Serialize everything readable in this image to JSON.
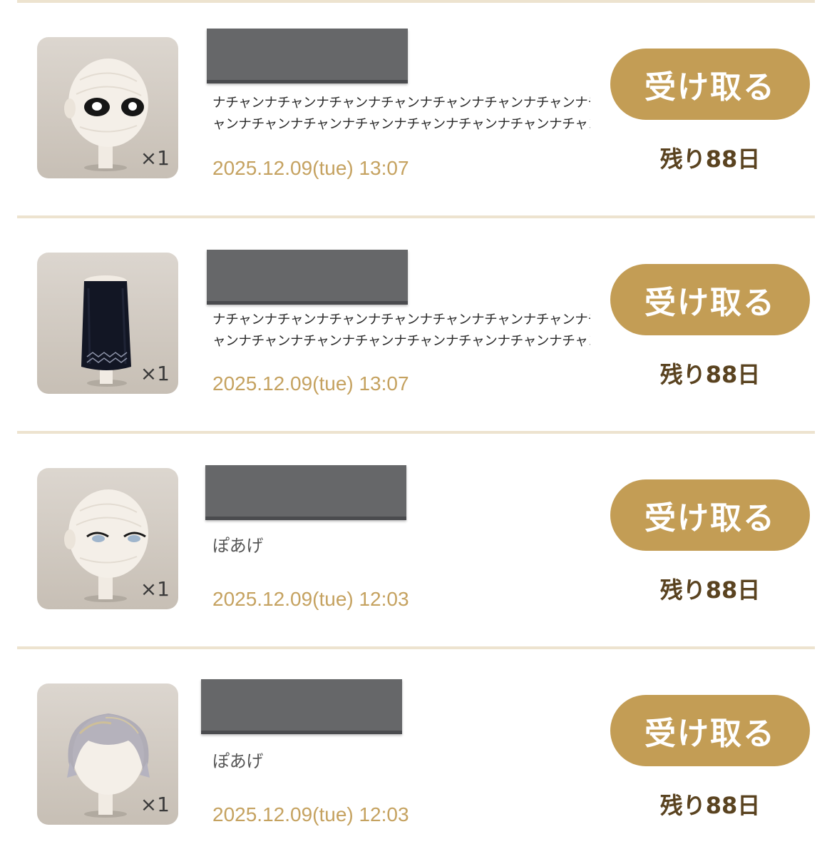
{
  "items": [
    {
      "quantity": "×1",
      "message_line1": "ナチャンナチャンナチャンナチャンナチャンナチャンナチャンナチャンナチャンナチ",
      "message_line2": "ャンナチャンナチャンナチャンナチャンナチャンナチャンナチャンナチャンナチ…",
      "date": "2025.12.09(tue) 13:07",
      "claim_label": "受け取る",
      "remaining": "残り88日",
      "thumbnail_icon": "mannequin-head-round-eyes-icon"
    },
    {
      "quantity": "×1",
      "message_line1": "ナチャンナチャンナチャンナチャンナチャンナチャンナチャンナチャンナチャンナチ",
      "message_line2": "ャンナチャンナチャンナチャンナチャンナチャンナチャンナチャンナチャンナチ…",
      "date": "2025.12.09(tue) 13:07",
      "claim_label": "受け取る",
      "remaining": "残り88日",
      "thumbnail_icon": "black-long-skirt-icon"
    },
    {
      "quantity": "×1",
      "message_line1": "ぽあげ",
      "message_line2": "",
      "date": "2025.12.09(tue) 12:03",
      "claim_label": "受け取る",
      "remaining": "残り88日",
      "thumbnail_icon": "mannequin-head-narrow-eyes-icon"
    },
    {
      "quantity": "×1",
      "message_line1": "ぽあげ",
      "message_line2": "",
      "date": "2025.12.09(tue) 12:03",
      "claim_label": "受け取る",
      "remaining": "残り88日",
      "thumbnail_icon": "grey-bob-hair-icon"
    }
  ],
  "colors": {
    "accent_gold": "#c39d55",
    "date_gold": "#c5a260",
    "divider": "#ede3cf",
    "redaction": "#666769"
  }
}
